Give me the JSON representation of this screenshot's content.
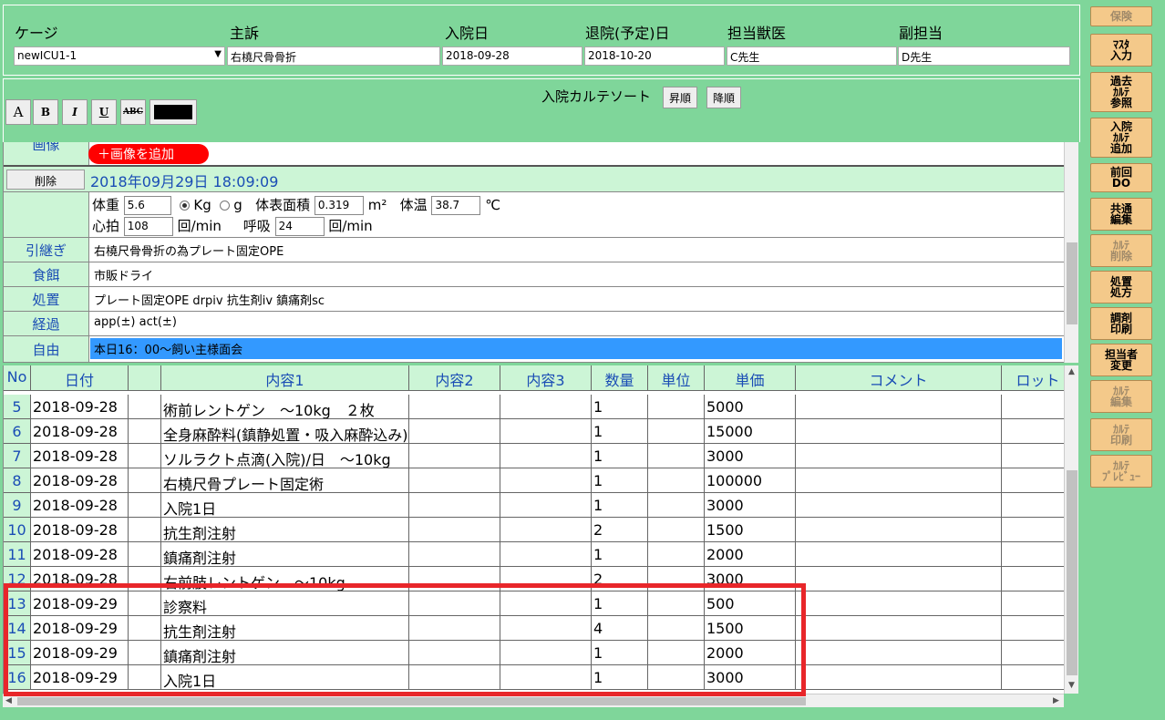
{
  "header": {
    "labels": [
      "ケージ",
      "主訴",
      "入院日",
      "退院(予定)日",
      "担当獣医",
      "副担当"
    ],
    "cage": "newICU1-1",
    "complaint": "右橈尺骨骨折",
    "admission_date": "2018-09-28",
    "discharge_date": "2018-10-20",
    "vet": "C先生",
    "sub_vet": "D先生"
  },
  "toolbar": {
    "font_buttons": [
      "A",
      "B",
      "I",
      "U",
      "ABC"
    ],
    "sort_label": "入院カルテソート",
    "asc": "昇順",
    "desc": "降順"
  },
  "form": {
    "image_label": "画像",
    "add_image": "＋画像を追加",
    "delete": "削除",
    "datetime": "2018年09月29日 18:09:09",
    "weight_label": "体重",
    "weight": "5.6",
    "unit_kg": "Kg",
    "unit_g": "g",
    "bsa_label": "体表面積",
    "bsa": "0.319",
    "bsa_unit": "m²",
    "temp_label": "体温",
    "temp": "38.7",
    "temp_unit": "℃",
    "hr_label": "心拍",
    "hr": "108",
    "hr_unit": "回/min",
    "rr_label": "呼吸",
    "rr": "24",
    "rr_unit": "回/min",
    "rows": [
      {
        "label": "引継ぎ",
        "value": "右橈尺骨骨折の為プレート固定OPE"
      },
      {
        "label": "食餌",
        "value": "市販ドライ"
      },
      {
        "label": "処置",
        "value": "プレート固定OPE drpiv 抗生剤iv 鎮痛剤sc"
      },
      {
        "label": "経過",
        "value": "app(±) act(±)"
      },
      {
        "label": "自由",
        "value": "本日16：00～飼い主様面会"
      }
    ]
  },
  "table": {
    "headers": [
      "No",
      "日付",
      "",
      "内容1",
      "内容2",
      "内容3",
      "数量",
      "単位",
      "単価",
      "コメント",
      "ロット"
    ],
    "rows": [
      {
        "no": "5",
        "date": "2018-09-28",
        "c1": "術前レントゲン　～10kg　２枚",
        "qty": "1",
        "price": "5000"
      },
      {
        "no": "6",
        "date": "2018-09-28",
        "c1": "全身麻酔料(鎮静処置・吸入麻酔込み)",
        "qty": "1",
        "price": "15000"
      },
      {
        "no": "7",
        "date": "2018-09-28",
        "c1": "ソルラクト点滴(入院)/日　～10kg",
        "qty": "1",
        "price": "3000"
      },
      {
        "no": "8",
        "date": "2018-09-28",
        "c1": "右橈尺骨プレート固定術",
        "qty": "1",
        "price": "100000"
      },
      {
        "no": "9",
        "date": "2018-09-28",
        "c1": "入院1日",
        "qty": "1",
        "price": "3000"
      },
      {
        "no": "10",
        "date": "2018-09-28",
        "c1": "抗生剤注射",
        "qty": "2",
        "price": "1500"
      },
      {
        "no": "11",
        "date": "2018-09-28",
        "c1": "鎮痛剤注射",
        "qty": "1",
        "price": "2000"
      },
      {
        "no": "12",
        "date": "2018-09-28",
        "c1": "右前肢レントゲン　～10kg",
        "qty": "2",
        "price": "3000"
      },
      {
        "no": "13",
        "date": "2018-09-29",
        "c1": "診察料",
        "qty": "1",
        "price": "500"
      },
      {
        "no": "14",
        "date": "2018-09-29",
        "c1": "抗生剤注射",
        "qty": "4",
        "price": "1500"
      },
      {
        "no": "15",
        "date": "2018-09-29",
        "c1": "鎮痛剤注射",
        "qty": "1",
        "price": "2000"
      },
      {
        "no": "16",
        "date": "2018-09-29",
        "c1": "入院1日",
        "qty": "1",
        "price": "3000"
      }
    ]
  },
  "side_buttons": [
    {
      "label": "保険",
      "enabled": false
    },
    {
      "label": "ﾏｽﾀ\n入力",
      "enabled": true
    },
    {
      "label": "過去\nｶﾙﾃ\n参照",
      "enabled": true
    },
    {
      "label": "入院\nｶﾙﾃ\n追加",
      "enabled": true
    },
    {
      "label": "前回\nDO",
      "enabled": true
    },
    {
      "label": "共通\n編集",
      "enabled": true
    },
    {
      "label": "ｶﾙﾃ\n削除",
      "enabled": false
    },
    {
      "label": "処置\n処方",
      "enabled": true
    },
    {
      "label": "調剤\n印刷",
      "enabled": true
    },
    {
      "label": "担当者\n変更",
      "enabled": true
    },
    {
      "label": "ｶﾙﾃ\n編集",
      "enabled": false
    },
    {
      "label": "ｶﾙﾃ\n印刷",
      "enabled": false
    },
    {
      "label": "ｶﾙﾃ\nﾌﾟﾚﾋﾞｭｰ",
      "enabled": false
    }
  ],
  "colors": {
    "background": "#7fd69a",
    "label_bg": "#ccf5d6",
    "label_text": "#1a4db5",
    "highlight_row": "#3399ff",
    "highlight_box": "#e8262a",
    "side_button": "#f4c98a"
  }
}
